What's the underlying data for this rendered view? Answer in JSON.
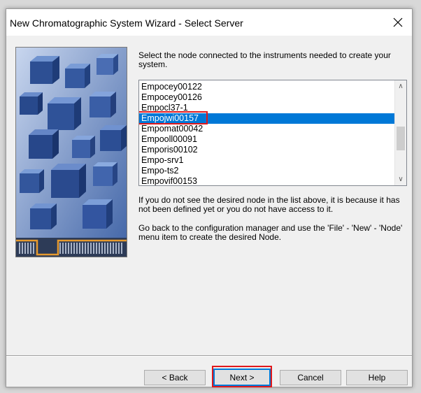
{
  "window": {
    "title": "New Chromatographic System Wizard - Select Server",
    "close_glyph": "✕"
  },
  "prompt": "Select the node connected to the instruments needed to create your system.",
  "node_list": {
    "items": [
      "Empocey00122",
      "Empocey00126",
      "Empocl37-1",
      "Empojwi00157",
      "Empomat00042",
      "Empooll00091",
      "Emporis00102",
      "Empo-srv1",
      "Empo-ts2",
      "Empovif00153"
    ],
    "selected": "Empojwi00157",
    "scroll_up_glyph": "∧",
    "scroll_down_glyph": "∨"
  },
  "info": {
    "line1": "If you do not see the desired node in the list above, it is because it has not been defined yet or you do not have access to it.",
    "line2": "Go back to the configuration manager and use the 'File' - 'New' - 'Node' menu item to create the desired Node."
  },
  "buttons": {
    "back": "< Back",
    "next": "Next >",
    "cancel": "Cancel",
    "help": "Help"
  },
  "colors": {
    "selection": "#0078d7",
    "highlight_box": "#e0181b",
    "art_background": "#5f84bd"
  },
  "icons": {
    "close": "close-icon",
    "scroll_up": "chevron-up-icon",
    "scroll_down": "chevron-down-icon"
  }
}
